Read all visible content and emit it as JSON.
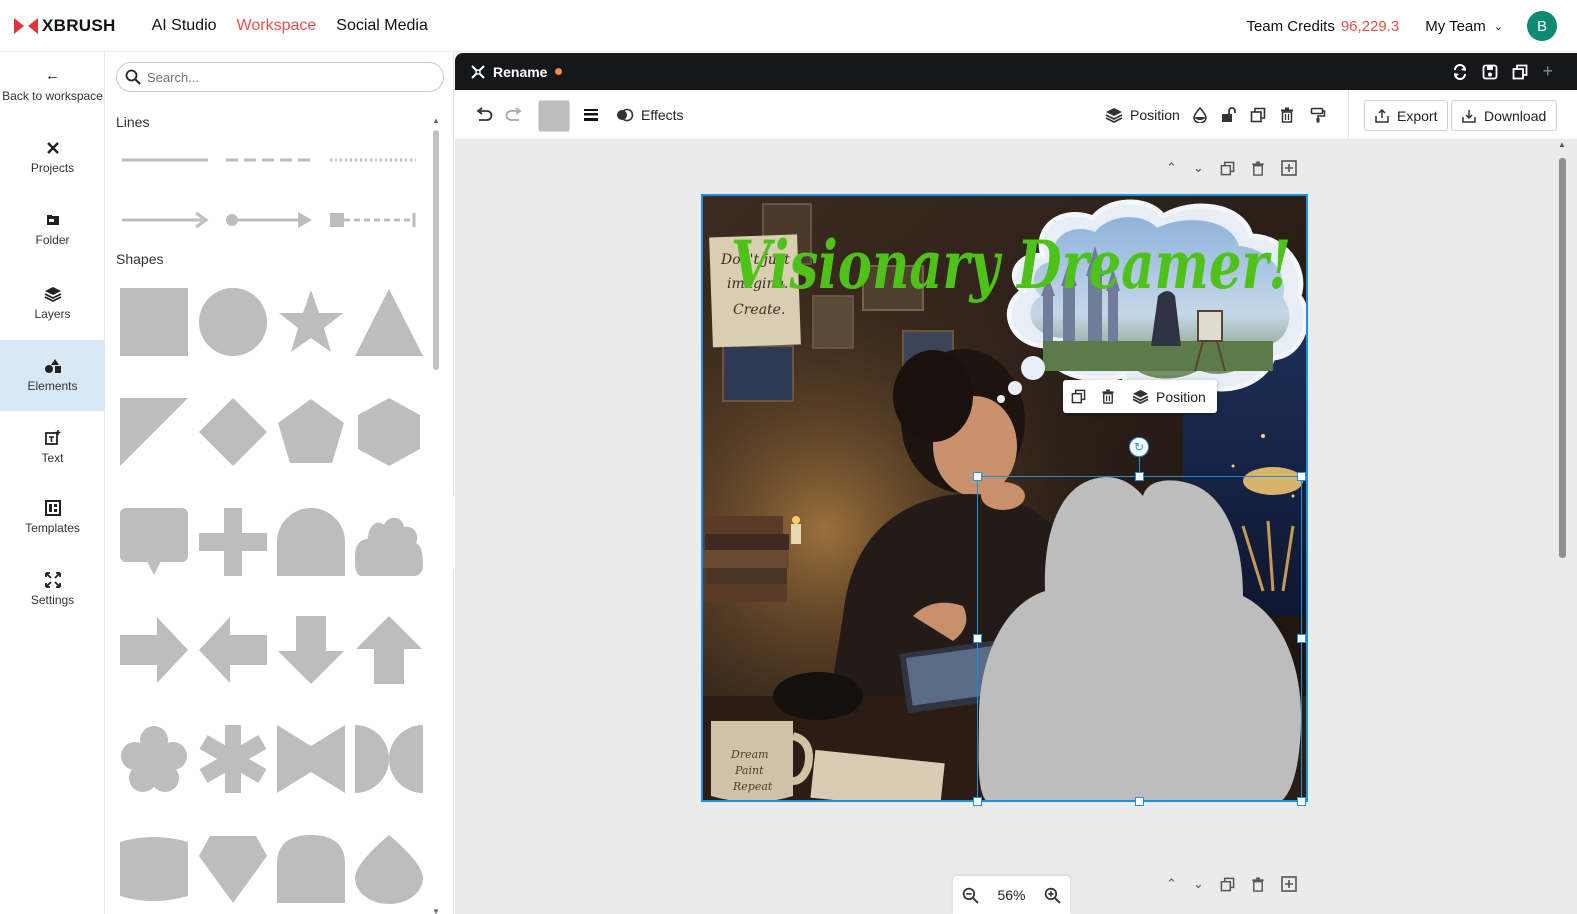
{
  "brand": {
    "name": "XBRUSH",
    "color": "#e0363b"
  },
  "nav": {
    "links": [
      "AI Studio",
      "Workspace",
      "Social Media"
    ],
    "active": "Workspace"
  },
  "header": {
    "credits_label": "Team Credits",
    "credits_value": "96,229.3",
    "team": "My Team",
    "avatar_initial": "B",
    "avatar_color": "#0e8a73"
  },
  "sidebar": {
    "items": [
      {
        "label": "Back to workspace",
        "icon": "arrow-left-icon"
      },
      {
        "label": "Projects",
        "icon": "projects-icon"
      },
      {
        "label": "Folder",
        "icon": "folder-icon"
      },
      {
        "label": "Layers",
        "icon": "layers-icon"
      },
      {
        "label": "Elements",
        "icon": "elements-icon"
      },
      {
        "label": "Text",
        "icon": "text-icon"
      },
      {
        "label": "Templates",
        "icon": "templates-icon"
      },
      {
        "label": "Settings",
        "icon": "settings-icon"
      }
    ],
    "active": "Elements"
  },
  "panel": {
    "search_placeholder": "Search...",
    "lines_title": "Lines",
    "shapes_title": "Shapes",
    "shape_color": "#bdbdbd"
  },
  "document": {
    "title": "Rename",
    "unsaved_color": "#f08a3c"
  },
  "toolbar": {
    "effects_label": "Effects",
    "position_label": "Position",
    "export_label": "Export",
    "download_label": "Download",
    "fill_color": "#bdbdbd"
  },
  "canvas": {
    "headline": "Visionary Dreamer!",
    "headline_color": "#4fc21a",
    "note_text_lines": [
      "Don't just",
      "imagine.",
      "Create."
    ],
    "mug_text_lines": [
      "Dream",
      "Paint",
      "Repeat"
    ],
    "selection_color": "#1e90e0"
  },
  "float_bar": {
    "position_label": "Position"
  },
  "zoom": {
    "level": "56%"
  }
}
